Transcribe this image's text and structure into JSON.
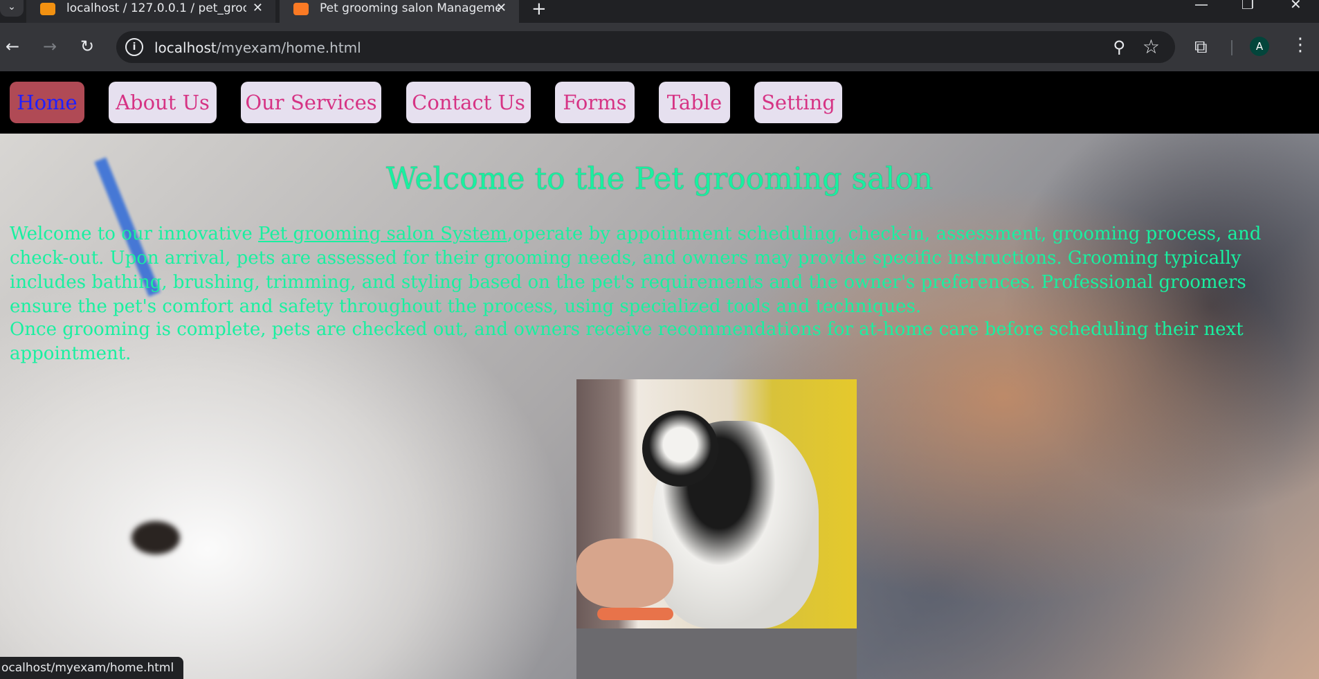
{
  "browser": {
    "tabs": [
      {
        "title": "localhost / 127.0.0.1 / pet_groo",
        "active": false,
        "favicon_color": "#f29111"
      },
      {
        "title": "Pet grooming salon Manageme",
        "active": true,
        "favicon_color": "#fb7a24"
      }
    ],
    "new_tab_glyph": "+",
    "address": {
      "host": "localhost",
      "path": "/myexam/home.html"
    },
    "profile_initial": "A",
    "status_url": "ocalhost/myexam/home.html"
  },
  "nav": {
    "items": [
      {
        "label": "Home",
        "active": true
      },
      {
        "label": "About Us",
        "active": false
      },
      {
        "label": "Our Services",
        "active": false
      },
      {
        "label": "Contact Us",
        "active": false
      },
      {
        "label": "Forms",
        "active": false
      },
      {
        "label": "Table",
        "active": false
      },
      {
        "label": "Setting",
        "active": false
      }
    ]
  },
  "hero": {
    "heading": "Welcome to the Pet grooming salon",
    "p1_prefix": "Welcome to our innovative ",
    "p1_link": "Pet grooming salon System",
    "p1_rest": ",operate by appointment scheduling, check-in, assessment, grooming process, and check-out. Upon arrival, pets are assessed for their grooming needs, and owners may provide specific instructions. Grooming typically includes bathing, brushing, trimming, and styling based on the pet's requirements and the owner's preferences. Professional groomers ensure the pet's comfort and safety throughout the process, using specialized tools and techniques.",
    "p2": "Once grooming is complete, pets are checked out, and owners receive recommendations for at-home care before scheduling their next appointment."
  },
  "colors": {
    "text_accent": "#19f0a0",
    "nav_text": "#d63384",
    "nav_active_bg": "#b04a55",
    "nav_active_text": "#1f1fff"
  },
  "icons": [
    "chevron-down-icon",
    "close-icon",
    "new-tab-icon",
    "back-icon",
    "forward-icon",
    "reload-icon",
    "site-info-icon",
    "zoom-icon",
    "bookmark-star-icon",
    "extensions-icon",
    "profile-avatar",
    "menu-kebab-icon",
    "minimize-icon",
    "restore-icon",
    "close-window-icon"
  ]
}
